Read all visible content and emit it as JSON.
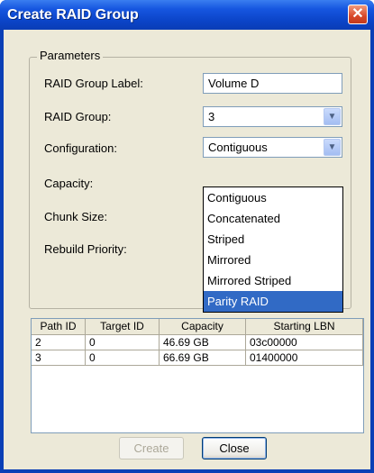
{
  "window": {
    "title": "Create RAID Group",
    "close_glyph": "✕"
  },
  "parameters": {
    "legend": "Parameters",
    "raid_group_label": {
      "label": "RAID Group Label:",
      "value": "Volume D"
    },
    "raid_group": {
      "label": "RAID Group:",
      "value": "3"
    },
    "configuration": {
      "label": "Configuration:",
      "value": "Contiguous"
    },
    "capacity": {
      "label": "Capacity:"
    },
    "chunk_size": {
      "label": "Chunk Size:"
    },
    "rebuild_priority": {
      "label": "Rebuild Priority:"
    }
  },
  "dropdown": {
    "options": [
      "Contiguous",
      "Concatenated",
      "Striped",
      "Mirrored",
      "Mirrored Striped",
      "Parity RAID"
    ],
    "highlighted": "Parity RAID"
  },
  "table": {
    "columns": [
      "Path ID",
      "Target ID",
      "Capacity",
      "Starting LBN"
    ],
    "rows": [
      [
        "2",
        "0",
        "46.69 GB",
        "03c00000"
      ],
      [
        "3",
        "0",
        "66.69 GB",
        "01400000"
      ]
    ]
  },
  "buttons": {
    "create": "Create",
    "close": "Close"
  },
  "icons": {
    "combo_arrow": "chevron-down-icon",
    "close": "close-icon"
  },
  "colors": {
    "titlebar": "#0b44c8",
    "selection": "#316ac5",
    "dialog_bg": "#ece9d8"
  }
}
